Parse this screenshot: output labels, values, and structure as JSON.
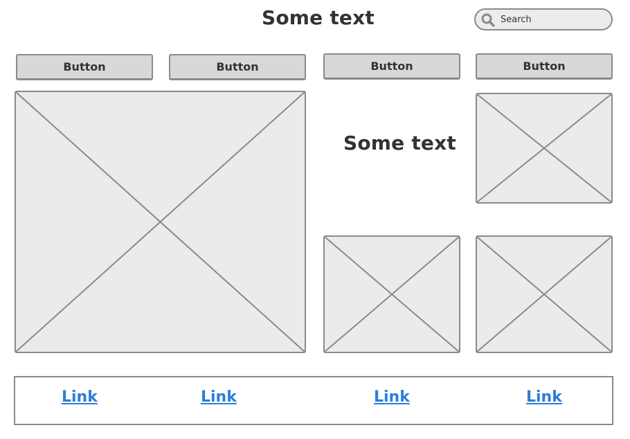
{
  "header": {
    "title": "Some text"
  },
  "search": {
    "placeholder": "Search",
    "icon": "search-icon"
  },
  "buttons": [
    {
      "label": "Button"
    },
    {
      "label": "Button"
    },
    {
      "label": "Button"
    },
    {
      "label": "Button"
    }
  ],
  "content": {
    "center_text": "Some text"
  },
  "links": [
    {
      "label": "Link"
    },
    {
      "label": "Link"
    },
    {
      "label": "Link"
    },
    {
      "label": "Link"
    }
  ],
  "colors": {
    "link": "#2a7fd6",
    "border": "#8a8a8a",
    "button_bg": "#d8d8d8",
    "placeholder_bg": "#ebebeb",
    "text": "#333333"
  }
}
